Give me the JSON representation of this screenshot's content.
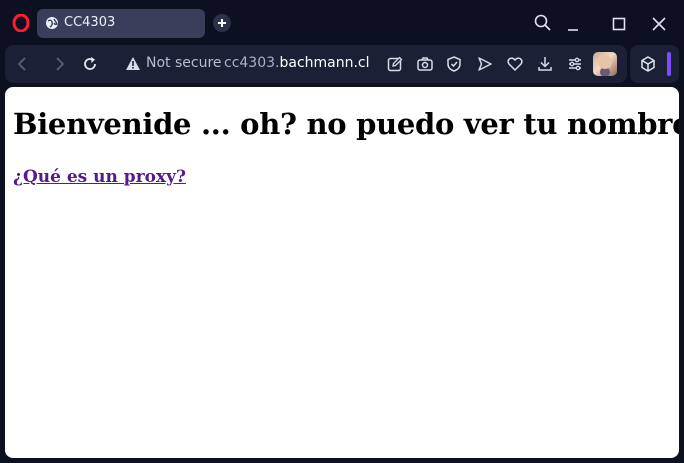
{
  "browser": {
    "tab_title": "CC4303",
    "address": {
      "security_label": "Not secure",
      "url_subdomain": "cc4303.",
      "url_domain": "bachmann.cl"
    },
    "icons": {
      "logo": "opera-logo",
      "tab_favicon": "globe-icon",
      "new_tab": "plus-icon",
      "search": "search-icon",
      "minimize": "minimize-icon",
      "maximize": "maximize-icon",
      "close": "close-icon",
      "back": "back-arrow-icon",
      "forward": "forward-arrow-icon",
      "reload": "reload-icon",
      "edit": "pencil-icon",
      "screenshot": "camera-icon",
      "vpn": "shield-icon",
      "send": "send-icon",
      "favorites": "heart-icon",
      "downloads": "download-icon",
      "easy_setup": "sliders-icon",
      "extensions": "cube-icon"
    },
    "colors": {
      "frame": "#0d1020",
      "toolbar": "#1c2036",
      "tab_active": "#3a3e5a",
      "accent": "#7b4dff",
      "opera_red": "#ff1b2d"
    }
  },
  "page": {
    "heading": "Bienvenide ... oh? no puedo ver tu nombre :c!",
    "link_text": "¿Qué es un proxy?",
    "link_color": "#551a8b"
  }
}
